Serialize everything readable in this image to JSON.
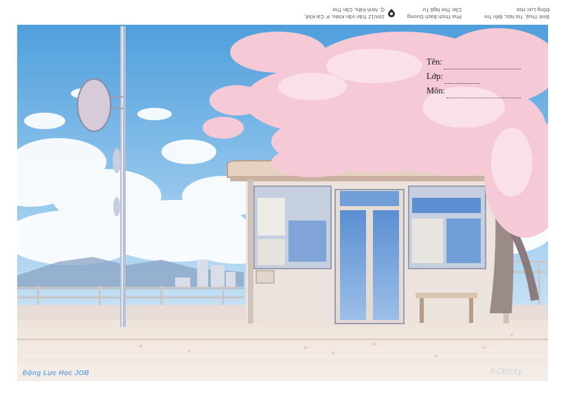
{
  "header_strip": {
    "col1_line1": "Bình Thuỷ, Trà Nóc, Bến Tre",
    "col1_line2": "Đồng Lực Học",
    "col2_line1": "Pha Thích Bách Dương",
    "col2_line2": "Cần Thơ Ngã Tư",
    "col3_line1": "19A/12 Trần Văn Khéo, P. Cái Khế,",
    "col3_line2": "Q. Ninh Kiều, Cần Thơ"
  },
  "form": {
    "name_label": "Tên:",
    "class_label": "Lớp:",
    "subject_label": "Môn:"
  },
  "brand": {
    "text": "Động Lực Học JOB"
  },
  "signature": {
    "text": "©Chinty"
  },
  "colors": {
    "sky_top": "#5aa6e0",
    "sky_bottom": "#cfe6f6",
    "blossom": "#f6c9d6",
    "shelter_wall": "#ece4dc",
    "window_blue": "#6f9fd6",
    "brand_blue": "#6fa9d8"
  }
}
